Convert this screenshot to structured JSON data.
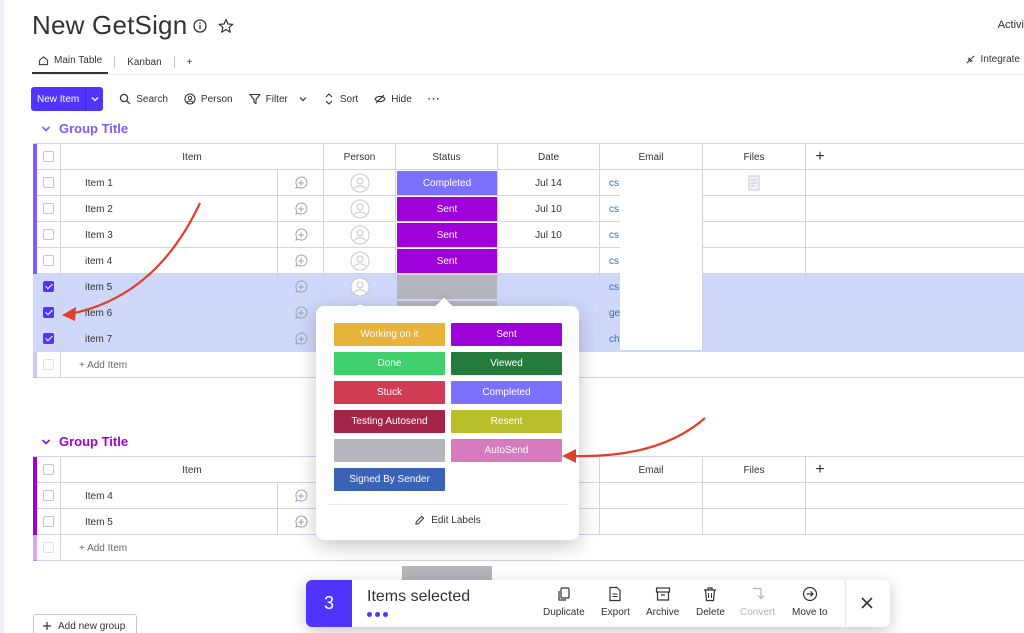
{
  "board": {
    "title": "New GetSign",
    "activity_label": "Activi"
  },
  "views": {
    "tabs": [
      "Main Table",
      "Kanban"
    ],
    "add": "+",
    "integrate": "Integrate"
  },
  "toolbar": {
    "new_item": "New Item",
    "search": "Search",
    "person": "Person",
    "filter": "Filter",
    "sort": "Sort",
    "hide": "Hide",
    "more": "···"
  },
  "columns": {
    "item": "Item",
    "person": "Person",
    "status": "Status",
    "date": "Date",
    "email": "Email",
    "files": "Files",
    "add": "+"
  },
  "group1": {
    "title": "Group Title",
    "color": "#7b5cff",
    "rows": [
      {
        "name": "Item 1",
        "status": "Completed",
        "status_color": "#7a72ff",
        "date": "Jul 14",
        "email": "cs",
        "checked": false,
        "has_file": true
      },
      {
        "name": "Item 2",
        "status": "Sent",
        "status_color": "#9d00d8",
        "date": "Jul 10",
        "email": "cs",
        "checked": false,
        "has_file": false
      },
      {
        "name": "Item 3",
        "status": "Sent",
        "status_color": "#9d00d8",
        "date": "Jul 10",
        "email": "cs",
        "checked": false,
        "has_file": false
      },
      {
        "name": "item 4",
        "status": "Sent",
        "status_color": "#9d00d8",
        "date": "",
        "email": "cs",
        "checked": false,
        "has_file": false
      },
      {
        "name": "item 5",
        "status": "",
        "status_color": "#b5b7bd",
        "date": "",
        "email": "cs",
        "checked": true,
        "has_file": false
      },
      {
        "name": "item 6",
        "status": "",
        "status_color": "#b5b7bd",
        "date": "",
        "email": "ge",
        "checked": true,
        "has_file": false
      },
      {
        "name": "item 7",
        "status": "",
        "status_color": "#b5b7bd",
        "date": "",
        "email": "ch",
        "checked": true,
        "has_file": false
      }
    ],
    "add_item": "+ Add Item"
  },
  "group2": {
    "title": "Group Title",
    "color": "#a300d0",
    "rows": [
      {
        "name": "Item 4"
      },
      {
        "name": "Item 5"
      }
    ],
    "add_item": "+ Add Item"
  },
  "status_popup": {
    "labels": [
      {
        "text": "Working on it",
        "color": "#e8b33a"
      },
      {
        "text": "Sent",
        "color": "#9d00d8"
      },
      {
        "text": "Done",
        "color": "#3fcf6c"
      },
      {
        "text": "Viewed",
        "color": "#257a3e"
      },
      {
        "text": "Stuck",
        "color": "#d03c54"
      },
      {
        "text": "Completed",
        "color": "#7a72ff"
      },
      {
        "text": "Testing Autosend",
        "color": "#a3264a"
      },
      {
        "text": "Resent",
        "color": "#b9bf2a"
      },
      {
        "text": "",
        "color": "#b5b7bd"
      },
      {
        "text": "AutoSend",
        "color": "#d77ac0"
      },
      {
        "text": "Signed By Sender",
        "color": "#3a62b7"
      }
    ],
    "edit_labels": "Edit Labels"
  },
  "selection_bar": {
    "count": "3",
    "text": "Items selected",
    "actions": [
      "Duplicate",
      "Export",
      "Archive",
      "Delete",
      "Convert",
      "Move to"
    ]
  },
  "add_group": "Add new group",
  "colors": {
    "accent": "#5034ff",
    "annotation_arrow": "#e0402a",
    "selected_row": "#cfd7fa"
  }
}
